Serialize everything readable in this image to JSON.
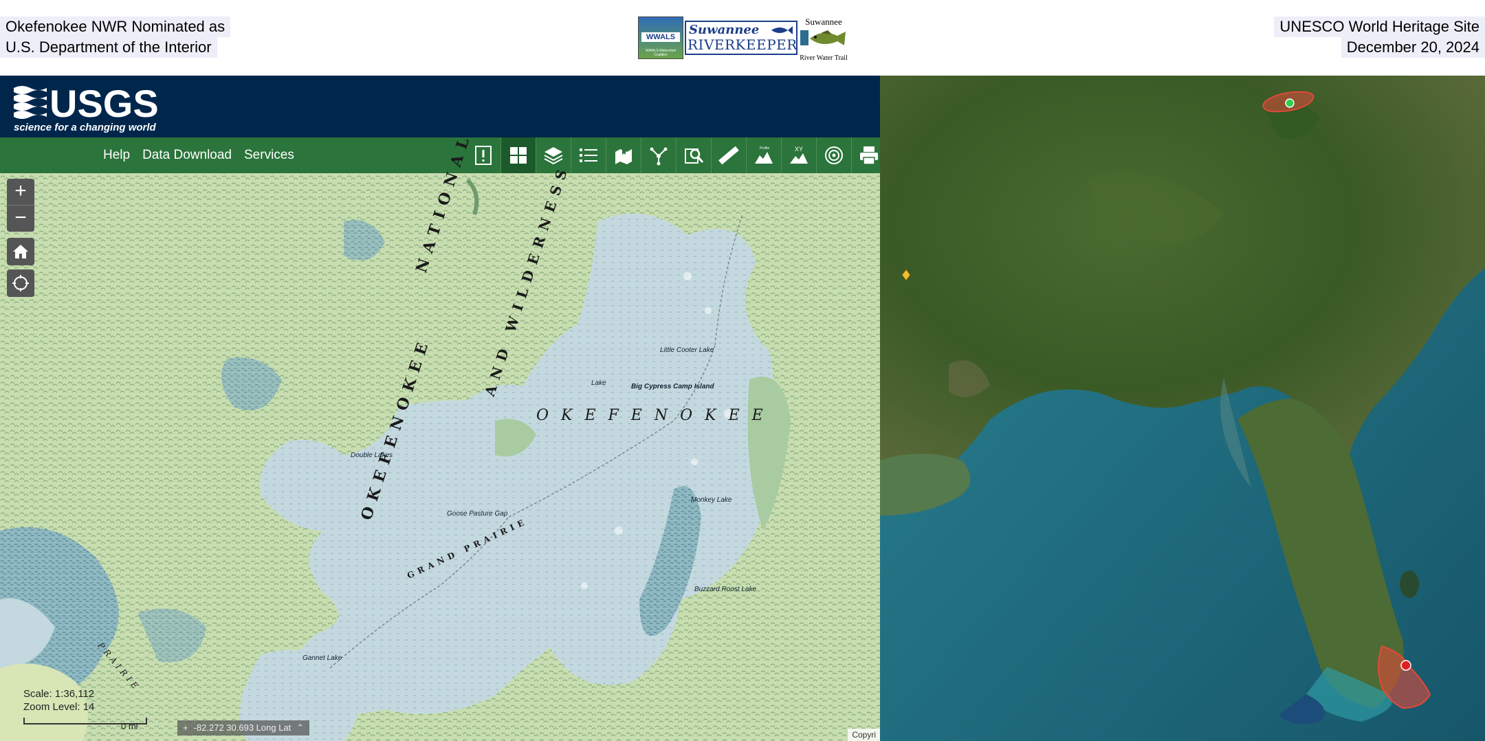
{
  "banner": {
    "left_line1": "Okefenokee NWR Nominated as",
    "left_line2": "U.S. Department of the Interior",
    "right_line1": "UNESCO World Heritage Site",
    "right_line2": "December 20, 2024",
    "logos": {
      "wwals_label": "WWALS",
      "wwals_sub": "WWALS Watershed Coalition",
      "riverkeeper_top": "Suwannee",
      "riverkeeper_bottom": "RIVERKEEPER",
      "water_trail_top": "Suwannee",
      "water_trail_bottom": "River Water Trail"
    }
  },
  "usgs": {
    "logo_text": "USGS",
    "tagline": "science for a changing world",
    "nav": [
      "Help",
      "Data Download",
      "Services"
    ],
    "tools": [
      "alert-icon",
      "grid-icon",
      "layers-icon",
      "list-icon",
      "bookmark-icon",
      "share-icon",
      "search-map-icon",
      "measure-icon",
      "profile-icon",
      "xy-icon",
      "target-icon",
      "print-icon"
    ],
    "tool_xy_label": "XY",
    "tool_profile_label": "Profile",
    "zoom_in": "+",
    "zoom_out": "−",
    "scale": "Scale: 1:36,112",
    "zoom_level": "Zoom Level: 14",
    "scale_label": "0 mi",
    "coordinates": "-82.272 30.693 Long Lat",
    "copyright": "Copyri"
  },
  "map_labels": {
    "nat1": "NATIONAL",
    "nat2": "AND WILDERNESS",
    "okefenokee_vertical": "OKEFENOKEE",
    "okefenokee_horizontal": "OKEFENOKEE",
    "grand_prairie": "GRAND PRAIRIE",
    "little_cooter": "Little Cooter Lake",
    "big_cypress": "Big Cypress Camp Island",
    "double_lakes": "Double Lakes",
    "goose_pasture": "Goose Pasture Gap",
    "monkey_lake": "Monkey Lake",
    "buzzard_roost": "Buzzard Roost Lake",
    "gannet_lake": "Gannet Lake",
    "prairie": "PRAIRIE",
    "tick": "Lake"
  },
  "colors": {
    "usgs_header": "#00264c",
    "usgs_toolbar": "#2b743b",
    "topo_land": "#c8ddb0",
    "topo_water": "#c4d9df",
    "sat_land": "#3f5f2a",
    "sat_water": "#1f6a78",
    "protected_area": "#e04a3a"
  }
}
